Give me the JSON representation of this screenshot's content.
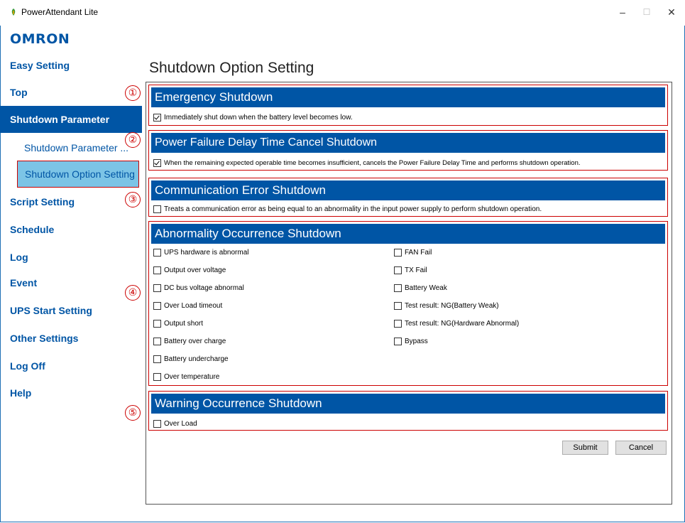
{
  "window": {
    "title": "PowerAttendant Lite",
    "minimize_glyph": "–",
    "maximize_glyph": "☐",
    "close_glyph": "✕"
  },
  "brand": {
    "logo_text": "OMRON"
  },
  "sidebar": {
    "items": [
      {
        "label": "Easy Setting"
      },
      {
        "label": "Top"
      },
      {
        "label": "Shutdown Parameter"
      },
      {
        "label": "Shutdown Parameter ..."
      },
      {
        "label": "Shutdown Option Setting"
      },
      {
        "label": "Script Setting"
      },
      {
        "label": "Schedule"
      },
      {
        "label": "Log"
      },
      {
        "label": "Event"
      },
      {
        "label": "UPS Start Setting"
      },
      {
        "label": "Other Settings"
      },
      {
        "label": "Log Off"
      },
      {
        "label": "Help"
      }
    ]
  },
  "main": {
    "title": "Shutdown Option Setting",
    "callouts": [
      "①",
      "②",
      "③",
      "④",
      "⑤"
    ],
    "emergency": {
      "heading": "Emergency Shutdown",
      "option": {
        "label": "Immediately shut down when the battery level becomes low.",
        "checked": true
      }
    },
    "power_failure": {
      "heading": "Power Failure Delay Time Cancel Shutdown",
      "option": {
        "label": "When the remaining expected operable time becomes insufficient, cancels the Power Failure Delay Time and performs shutdown operation.",
        "checked": true
      }
    },
    "communication": {
      "heading": "Communication Error Shutdown",
      "option": {
        "label": "Treats a communication error as being equal to an abnormality in the input power supply to perform shutdown operation.",
        "checked": false
      }
    },
    "abnormality": {
      "heading": "Abnormality Occurrence Shutdown",
      "left": [
        {
          "label": "UPS hardware is abnormal",
          "checked": false
        },
        {
          "label": "Output over voltage",
          "checked": false
        },
        {
          "label": "DC bus voltage abnormal",
          "checked": false
        },
        {
          "label": "Over Load timeout",
          "checked": false
        },
        {
          "label": "Output short",
          "checked": false
        },
        {
          "label": "Battery over charge",
          "checked": false
        },
        {
          "label": "Battery undercharge",
          "checked": false
        },
        {
          "label": "Over temperature",
          "checked": false
        }
      ],
      "right": [
        {
          "label": "FAN Fail",
          "checked": false
        },
        {
          "label": "TX Fail",
          "checked": false
        },
        {
          "label": "Battery Weak",
          "checked": false
        },
        {
          "label": "Test result: NG(Battery Weak)",
          "checked": false
        },
        {
          "label": "Test result: NG(Hardware Abnormal)",
          "checked": false
        },
        {
          "label": "Bypass",
          "checked": false
        }
      ]
    },
    "warning": {
      "heading": "Warning Occurrence Shutdown",
      "option": {
        "label": "Over Load",
        "checked": false
      }
    },
    "buttons": {
      "submit": "Submit",
      "cancel": "Cancel"
    }
  },
  "colors": {
    "brand_blue": "#0055a5",
    "selected_bg": "#7cc4e6",
    "highlight_red": "#cc0000"
  }
}
